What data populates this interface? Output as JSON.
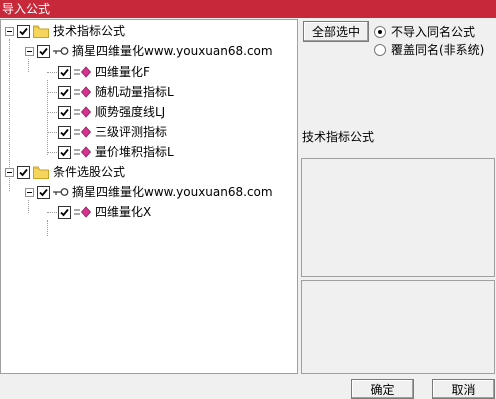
{
  "window": {
    "title": "导入公式"
  },
  "tree": {
    "groups": [
      {
        "label": "技术指标公式",
        "publisher": "摘星四维量化www.youxuan68.com",
        "items": [
          "四维量化F",
          "随机动量指标L",
          "顺势强度线LJ",
          "三级评测指标",
          "量价堆积指标L"
        ]
      },
      {
        "label": "条件选股公式",
        "publisher": "摘星四维量化www.youxuan68.com",
        "items": [
          "四维量化X"
        ]
      }
    ]
  },
  "controls": {
    "select_all_label": "全部选中",
    "options": [
      {
        "label": "不导入同名公式",
        "selected": true
      },
      {
        "label": "覆盖同名(非系统)",
        "selected": false
      }
    ],
    "section_label": "技术指标公式",
    "ok_label": "确定",
    "cancel_label": "取消"
  }
}
